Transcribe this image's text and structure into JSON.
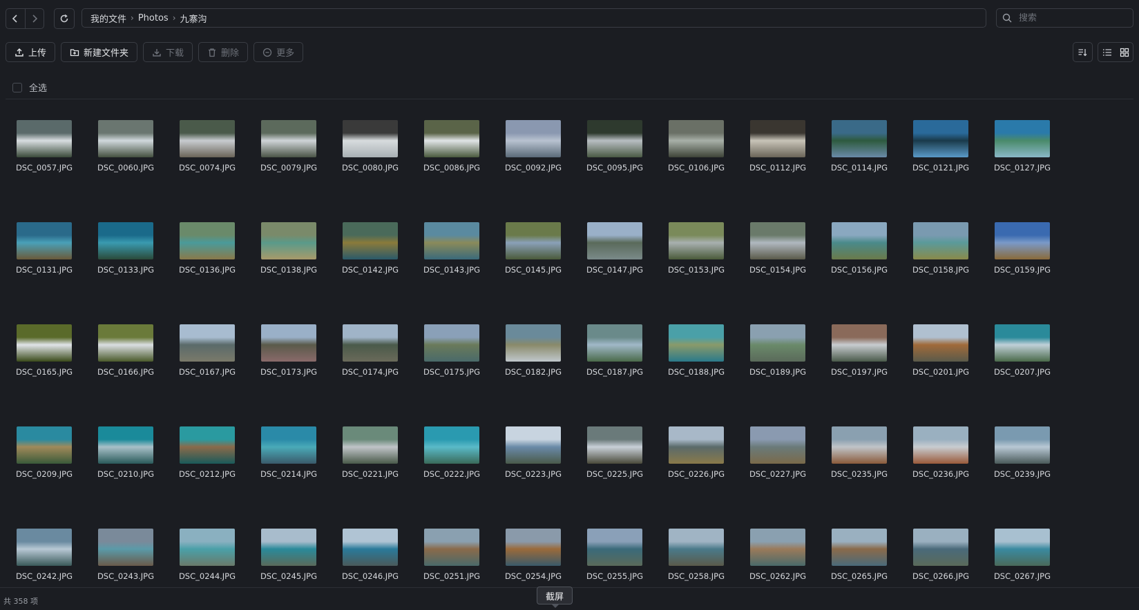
{
  "breadcrumb": [
    "我的文件",
    "Photos",
    "九寨沟"
  ],
  "search": {
    "placeholder": "搜索"
  },
  "toolbar": {
    "upload_label": "上传",
    "new_folder_label": "新建文件夹",
    "download_label": "下载",
    "delete_label": "删除",
    "more_label": "更多"
  },
  "select_all_label": "全选",
  "status": {
    "count_label": "共 358 项"
  },
  "tooltip": {
    "label": "截屏"
  },
  "files": [
    {
      "name": "DSC_0057.JPG",
      "colors": [
        "#5a6a6a",
        "#d8dde0",
        "#3a4a3a"
      ]
    },
    {
      "name": "DSC_0060.JPG",
      "colors": [
        "#6a7670",
        "#d0d8dc",
        "#44503f"
      ]
    },
    {
      "name": "DSC_0074.JPG",
      "colors": [
        "#4a5a4a",
        "#c8ccd0",
        "#6a6458"
      ]
    },
    {
      "name": "DSC_0079.JPG",
      "colors": [
        "#5c6a5c",
        "#cfd4d8",
        "#4a5446"
      ]
    },
    {
      "name": "DSC_0080.JPG",
      "colors": [
        "#3a3a3a",
        "#d8dcde",
        "#a8b0b4"
      ]
    },
    {
      "name": "DSC_0086.JPG",
      "colors": [
        "#5a6448",
        "#e0e4e6",
        "#4a5a3e"
      ]
    },
    {
      "name": "DSC_0092.JPG",
      "colors": [
        "#8a98b0",
        "#b8c2d0",
        "#5a6a78"
      ]
    },
    {
      "name": "DSC_0095.JPG",
      "colors": [
        "#2e3a2e",
        "#b8bec2",
        "#4a5a44"
      ]
    },
    {
      "name": "DSC_0106.JPG",
      "colors": [
        "#6a7066",
        "#a8b0a8",
        "#3e4438"
      ]
    },
    {
      "name": "DSC_0112.JPG",
      "colors": [
        "#3a3630",
        "#c8c4b8",
        "#6a6458"
      ]
    },
    {
      "name": "DSC_0114.JPG",
      "colors": [
        "#3a6a88",
        "#2e5a3e",
        "#6a8aa8"
      ]
    },
    {
      "name": "DSC_0121.JPG",
      "colors": [
        "#2a6a9a",
        "#1a3a4a",
        "#5a9ac8"
      ]
    },
    {
      "name": "DSC_0127.JPG",
      "colors": [
        "#2a7aaa",
        "#4a8a6a",
        "#8ab8c8"
      ]
    },
    {
      "name": "DSC_0131.JPG",
      "colors": [
        "#2a6a8a",
        "#4aa0b8",
        "#6a5a3a"
      ]
    },
    {
      "name": "DSC_0133.JPG",
      "colors": [
        "#1a6a8a",
        "#3a9ab0",
        "#2a4a3a"
      ]
    },
    {
      "name": "DSC_0136.JPG",
      "colors": [
        "#6a8a6a",
        "#4a9a9a",
        "#8a7a4a"
      ]
    },
    {
      "name": "DSC_0138.JPG",
      "colors": [
        "#7a8a6a",
        "#5a9a8a",
        "#a89a6a"
      ]
    },
    {
      "name": "DSC_0142.JPG",
      "colors": [
        "#4a6a5a",
        "#8a7a3a",
        "#2a5a6a"
      ]
    },
    {
      "name": "DSC_0143.JPG",
      "colors": [
        "#5a8aa0",
        "#8a8a5a",
        "#3a6a7a"
      ]
    },
    {
      "name": "DSC_0145.JPG",
      "colors": [
        "#6a7a4a",
        "#8aa0b8",
        "#4a5a3a"
      ]
    },
    {
      "name": "DSC_0147.JPG",
      "colors": [
        "#9ab0c8",
        "#5a6a5a",
        "#7a8a8a"
      ]
    },
    {
      "name": "DSC_0153.JPG",
      "colors": [
        "#7a8a5a",
        "#a8b0b0",
        "#4a5a3a"
      ]
    },
    {
      "name": "DSC_0154.JPG",
      "colors": [
        "#6a7a6a",
        "#b0b8c0",
        "#5a5a4a"
      ]
    },
    {
      "name": "DSC_0156.JPG",
      "colors": [
        "#8aa8c0",
        "#4a8a8a",
        "#6a7a4a"
      ]
    },
    {
      "name": "DSC_0158.JPG",
      "colors": [
        "#7a9ab0",
        "#5a9a9a",
        "#8a8a4a"
      ]
    },
    {
      "name": "DSC_0159.JPG",
      "colors": [
        "#3a6ab0",
        "#7a9ac8",
        "#8a6a3a"
      ]
    },
    {
      "name": "DSC_0165.JPG",
      "colors": [
        "#5a6a2a",
        "#e0e4e8",
        "#3a4a1a"
      ]
    },
    {
      "name": "DSC_0166.JPG",
      "colors": [
        "#6a7a3a",
        "#dadee2",
        "#4a5a2a"
      ]
    },
    {
      "name": "DSC_0167.JPG",
      "colors": [
        "#a8bcd0",
        "#5a6a6a",
        "#7a7a6a"
      ]
    },
    {
      "name": "DSC_0173.JPG",
      "colors": [
        "#9ab0c8",
        "#5a5a4a",
        "#8a6a6a"
      ]
    },
    {
      "name": "DSC_0174.JPG",
      "colors": [
        "#a0b4c8",
        "#4a5a4a",
        "#6a6a5a"
      ]
    },
    {
      "name": "DSC_0175.JPG",
      "colors": [
        "#8aa0b8",
        "#6a7a5a",
        "#4a6a6a"
      ]
    },
    {
      "name": "DSC_0182.JPG",
      "colors": [
        "#6a8a9a",
        "#8a8a6a",
        "#c0c8cc"
      ]
    },
    {
      "name": "DSC_0187.JPG",
      "colors": [
        "#6a8a8a",
        "#a0b8c8",
        "#4a6a4a"
      ]
    },
    {
      "name": "DSC_0188.JPG",
      "colors": [
        "#4aa0a8",
        "#8a9a6a",
        "#2a7a8a"
      ]
    },
    {
      "name": "DSC_0189.JPG",
      "colors": [
        "#8aa0b0",
        "#6a8a6a",
        "#5a6a5a"
      ]
    },
    {
      "name": "DSC_0197.JPG",
      "colors": [
        "#8a6a5a",
        "#c8ccd0",
        "#4a5a4a"
      ]
    },
    {
      "name": "DSC_0201.JPG",
      "colors": [
        "#b0c0d0",
        "#a06a3a",
        "#5a5a4a"
      ]
    },
    {
      "name": "DSC_0207.JPG",
      "colors": [
        "#2a8a9a",
        "#c0d0d8",
        "#4a6a4a"
      ]
    },
    {
      "name": "DSC_0209.JPG",
      "colors": [
        "#2a8aa0",
        "#a08a5a",
        "#3a5a3a"
      ]
    },
    {
      "name": "DSC_0210.JPG",
      "colors": [
        "#1a8a9a",
        "#a8c0c8",
        "#2a5a5a"
      ]
    },
    {
      "name": "DSC_0212.JPG",
      "colors": [
        "#2a9aa0",
        "#8a6a4a",
        "#1a5a5a"
      ]
    },
    {
      "name": "DSC_0214.JPG",
      "colors": [
        "#2a8aa8",
        "#4aaab8",
        "#3a5a6a"
      ]
    },
    {
      "name": "DSC_0221.JPG",
      "colors": [
        "#6a8a7a",
        "#c0c4c8",
        "#4a5a4a"
      ]
    },
    {
      "name": "DSC_0222.JPG",
      "colors": [
        "#2a9ab0",
        "#5abac8",
        "#3a6a5a"
      ]
    },
    {
      "name": "DSC_0223.JPG",
      "colors": [
        "#c8d4e0",
        "#6a8aa8",
        "#4a5a4a"
      ]
    },
    {
      "name": "DSC_0225.JPG",
      "colors": [
        "#6a7a7a",
        "#c8d0d8",
        "#4a4a3a"
      ]
    },
    {
      "name": "DSC_0226.JPG",
      "colors": [
        "#a8b8c8",
        "#5a6a6a",
        "#8a7a4a"
      ]
    },
    {
      "name": "DSC_0227.JPG",
      "colors": [
        "#8a9ab0",
        "#6a7a7a",
        "#7a6a4a"
      ]
    },
    {
      "name": "DSC_0235.JPG",
      "colors": [
        "#8aa0b0",
        "#c0c4c8",
        "#8a5a3a"
      ]
    },
    {
      "name": "DSC_0236.JPG",
      "colors": [
        "#9ab0c0",
        "#c8ccd0",
        "#9a5a3a"
      ]
    },
    {
      "name": "DSC_0239.JPG",
      "colors": [
        "#7a9ab0",
        "#b8c8d4",
        "#4a5a5a"
      ]
    },
    {
      "name": "DSC_0242.JPG",
      "colors": [
        "#6a8aa0",
        "#b8c8d4",
        "#3a5a5a"
      ]
    },
    {
      "name": "DSC_0243.JPG",
      "colors": [
        "#7a8a9a",
        "#5a9aa8",
        "#6a5a4a"
      ]
    },
    {
      "name": "DSC_0244.JPG",
      "colors": [
        "#8ab0c0",
        "#4aa0a8",
        "#6a7a6a"
      ]
    },
    {
      "name": "DSC_0245.JPG",
      "colors": [
        "#a8bccc",
        "#2a8a9a",
        "#5a6a5a"
      ]
    },
    {
      "name": "DSC_0246.JPG",
      "colors": [
        "#b0c4d4",
        "#2a7a9a",
        "#4a5a5a"
      ]
    },
    {
      "name": "DSC_0251.JPG",
      "colors": [
        "#8aa0b0",
        "#8a6a4a",
        "#4a6a6a"
      ]
    },
    {
      "name": "DSC_0254.JPG",
      "colors": [
        "#8a9aaa",
        "#9a6a3a",
        "#3a5a6a"
      ]
    },
    {
      "name": "DSC_0255.JPG",
      "colors": [
        "#8aa0b8",
        "#3a6a7a",
        "#5a6a5a"
      ]
    },
    {
      "name": "DSC_0258.JPG",
      "colors": [
        "#a0b4c4",
        "#4a7a8a",
        "#5a5a4a"
      ]
    },
    {
      "name": "DSC_0262.JPG",
      "colors": [
        "#8aa0b0",
        "#9a7a5a",
        "#4a6a6a"
      ]
    },
    {
      "name": "DSC_0265.JPG",
      "colors": [
        "#9ab0c0",
        "#8a6a4a",
        "#4a6a7a"
      ]
    },
    {
      "name": "DSC_0266.JPG",
      "colors": [
        "#9ab0c0",
        "#4a6a7a",
        "#5a6a5a"
      ]
    },
    {
      "name": "DSC_0267.JPG",
      "colors": [
        "#a8c0d0",
        "#3a8aa0",
        "#4a6a5a"
      ]
    }
  ]
}
